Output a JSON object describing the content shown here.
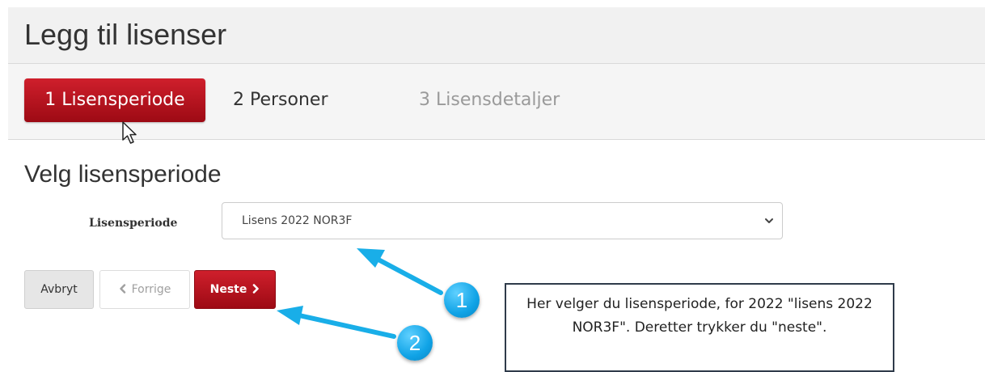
{
  "header": {
    "title": "Legg til lisenser"
  },
  "steps": [
    {
      "label": "1 Lisensperiode",
      "state": "active"
    },
    {
      "label": "2 Personer",
      "state": "default"
    },
    {
      "label": "3 Lisensdetaljer",
      "state": "disabled"
    }
  ],
  "section": {
    "title": "Velg lisensperiode"
  },
  "form": {
    "license_period_label": "Lisensperiode",
    "license_period_value": "Lisens 2022 NOR3F"
  },
  "buttons": {
    "cancel": "Avbryt",
    "previous": "Forrige",
    "next": "Neste"
  },
  "annotations": {
    "badge_1": "1",
    "badge_2": "2",
    "callout_text": "Her velger du lisensperiode, for 2022 \"lisens 2022 NOR3F\". Deretter trykker du \"neste\"."
  },
  "icons": {
    "cursor": "cursor-icon",
    "select_chevron": "chevron-down-icon",
    "previous": "chevron-left-icon",
    "next": "chevron-right-icon",
    "arrows": "arrow-icon"
  },
  "colors": {
    "accent_red": "#c0141f",
    "annotation_blue": "#19aee8",
    "header_bg": "#f1f1f1"
  }
}
